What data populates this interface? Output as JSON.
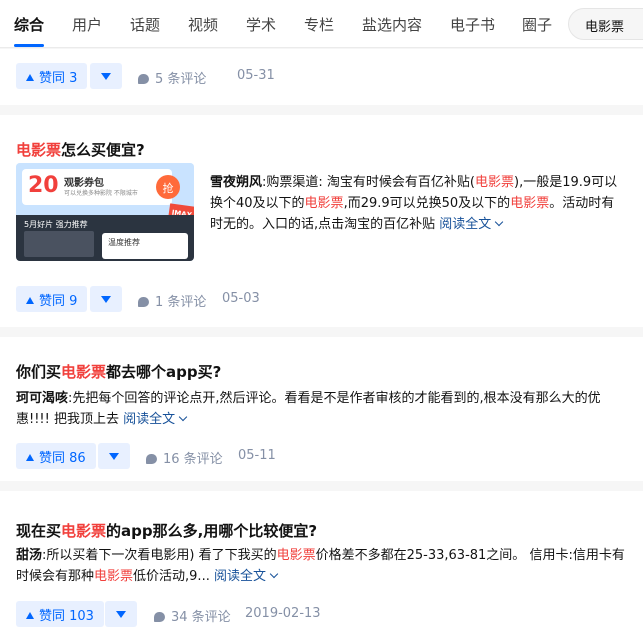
{
  "tabs": [
    {
      "label": "综合",
      "active": true
    },
    {
      "label": "用户"
    },
    {
      "label": "话题"
    },
    {
      "label": "视频"
    },
    {
      "label": "学术"
    },
    {
      "label": "专栏"
    },
    {
      "label": "盐选内容"
    },
    {
      "label": "电子书"
    },
    {
      "label": "圈子"
    }
  ],
  "search": {
    "query": "电影票"
  },
  "colors": {
    "accent": "#0066ff",
    "highlight": "#f1403c",
    "link": "#175199",
    "meta": "#8590a6"
  },
  "cards": [
    {
      "vote_label": "赞同 3",
      "comments": "5 条评论",
      "date": "05-31"
    },
    {
      "title_hl": "电影票",
      "title_rest": "怎么买便宜?",
      "author": "雪夜朔风",
      "excerpt": [
        {
          "text": ":购票渠道: 淘宝有时候会有百亿补贴("
        },
        {
          "text": "电影票",
          "hl": true
        },
        {
          "text": "),一般是19.9可以换个40及以下的"
        },
        {
          "text": "电影票",
          "hl": true
        },
        {
          "text": ",而29.9可以兑换50及以下的"
        },
        {
          "text": "电影票",
          "hl": true
        },
        {
          "text": "。活动时有时无的。入口的话,点击淘宝的百亿补贴 "
        }
      ],
      "read_more": "阅读全文",
      "thumbnail": {
        "amount": "20",
        "title": "观影券包",
        "subtitle": "可以兑换多种影院 不限城市",
        "button": "抢",
        "badge": "IMAX 10",
        "movie": "5月好片 强力推荐",
        "ticket": "温度推荐"
      },
      "vote_label": "赞同 9",
      "comments": "1 条评论",
      "date": "05-03"
    },
    {
      "title_pre": "你们买",
      "title_hl": "电影票",
      "title_rest": "都去哪个app买?",
      "author": "珂可渴咳",
      "excerpt": [
        {
          "text": ":先把每个回答的评论点开,然后评论。看看是不是作者审核的才能看到的,根本没有那么大的优惠!!!! 把我顶上去 "
        }
      ],
      "read_more": "阅读全文",
      "vote_label": "赞同 86",
      "comments": "16 条评论",
      "date": "05-11"
    },
    {
      "title_pre": "现在买",
      "title_hl": "电影票",
      "title_rest": "的app那么多,用哪个比较便宜?",
      "author": "甜汤",
      "excerpt": [
        {
          "text": ":所以买着下一次看电影用) 看了下我买的"
        },
        {
          "text": "电影票",
          "hl": true
        },
        {
          "text": "价格差不多都在25-33,63-81之间。 信用卡:信用卡有时候会有那种"
        },
        {
          "text": "电影票",
          "hl": true
        },
        {
          "text": "低价活动,9... "
        }
      ],
      "read_more": "阅读全文",
      "vote_label": "赞同 103",
      "comments": "34 条评论",
      "date": "2019-02-13"
    }
  ]
}
